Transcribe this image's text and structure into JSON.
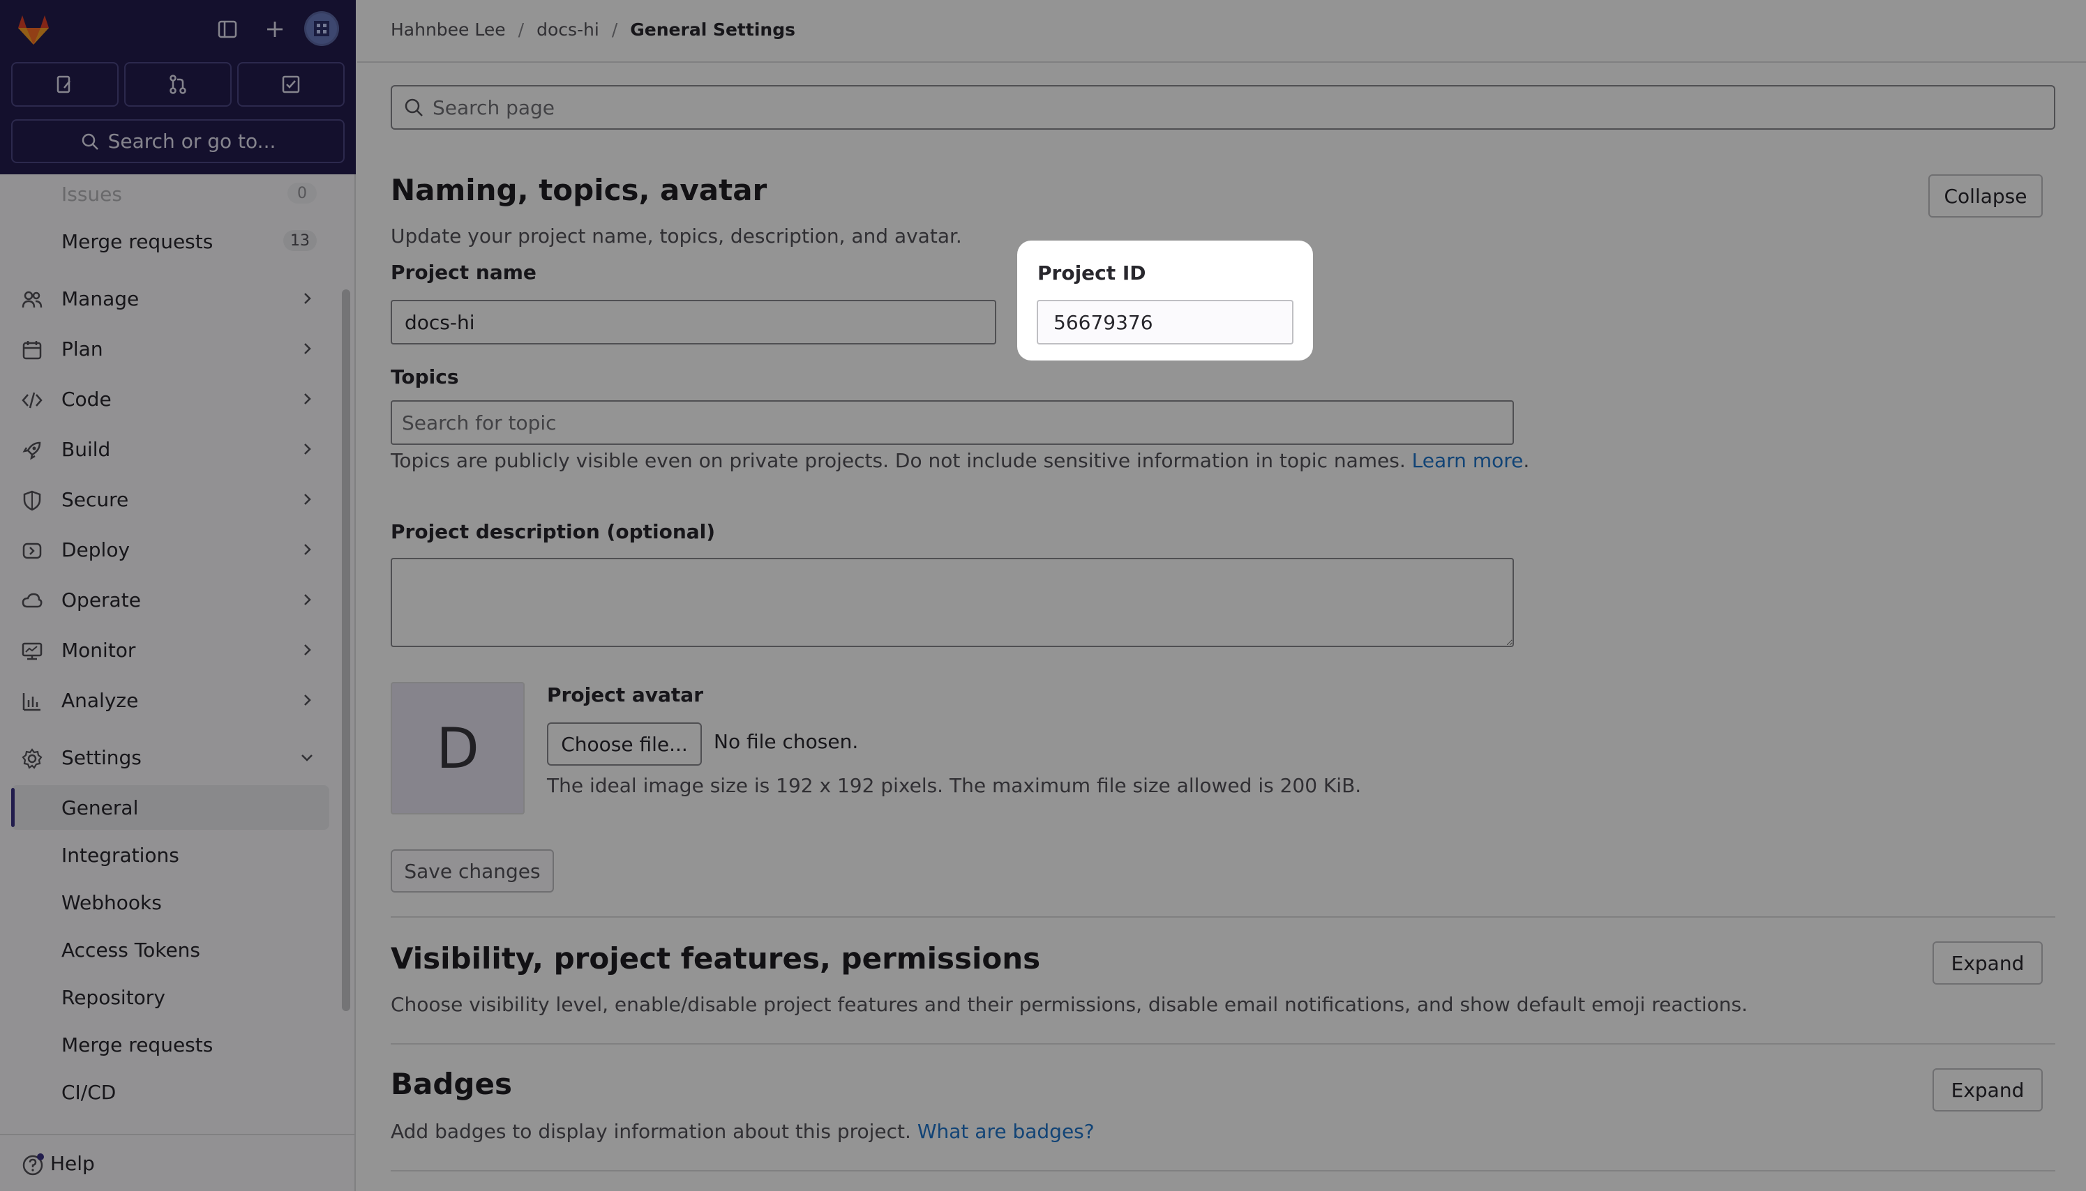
{
  "sidebar": {
    "search_label": "Search or go to...",
    "tiles": [
      "issues-icon",
      "merge-requests-icon",
      "todo-icon"
    ],
    "partial_items": [
      {
        "label": "Issues",
        "count": "0"
      },
      {
        "label": "Merge requests",
        "count": "13"
      }
    ],
    "nav": [
      {
        "label": "Manage",
        "icon": "users-icon"
      },
      {
        "label": "Plan",
        "icon": "calendar-icon"
      },
      {
        "label": "Code",
        "icon": "code-icon"
      },
      {
        "label": "Build",
        "icon": "rocket-icon"
      },
      {
        "label": "Secure",
        "icon": "shield-icon"
      },
      {
        "label": "Deploy",
        "icon": "deploy-icon"
      },
      {
        "label": "Operate",
        "icon": "cloud-icon"
      },
      {
        "label": "Monitor",
        "icon": "monitor-icon"
      },
      {
        "label": "Analyze",
        "icon": "chart-icon"
      }
    ],
    "settings": {
      "label": "Settings",
      "children": [
        "General",
        "Integrations",
        "Webhooks",
        "Access Tokens",
        "Repository",
        "Merge requests",
        "CI/CD"
      ]
    },
    "help_label": "Help"
  },
  "breadcrumb": [
    "Hahnbee Lee",
    "docs-hi",
    "General Settings"
  ],
  "search_page": {
    "placeholder": "Search page"
  },
  "naming": {
    "title": "Naming, topics, avatar",
    "description": "Update your project name, topics, description, and avatar.",
    "collapse_label": "Collapse",
    "project_name_label": "Project name",
    "project_name_value": "docs-hi",
    "project_id_label": "Project ID",
    "project_id_value": "56679376",
    "topics_label": "Topics",
    "topics_placeholder": "Search for topic",
    "topics_help": "Topics are publicly visible even on private projects. Do not include sensitive information in topic names.",
    "topics_link": "Learn more",
    "description_label": "Project description (optional)",
    "avatar_letter": "D",
    "avatar_label": "Project avatar",
    "choose_file_label": "Choose file...",
    "no_file_text": "No file chosen.",
    "avatar_help": "The ideal image size is 192 x 192 pixels. The maximum file size allowed is 200 KiB.",
    "save_label": "Save changes"
  },
  "visibility": {
    "title": "Visibility, project features, permissions",
    "description": "Choose visibility level, enable/disable project features and their permissions, disable email notifications, and show default emoji reactions.",
    "expand_label": "Expand"
  },
  "badges": {
    "title": "Badges",
    "description": "Add badges to display information about this project.",
    "link": "What are badges?",
    "expand_label": "Expand"
  },
  "colors": {
    "sidebar_top": "#231d4f",
    "link": "#1f75cb",
    "avatar_bg": "#e7e4f2"
  }
}
